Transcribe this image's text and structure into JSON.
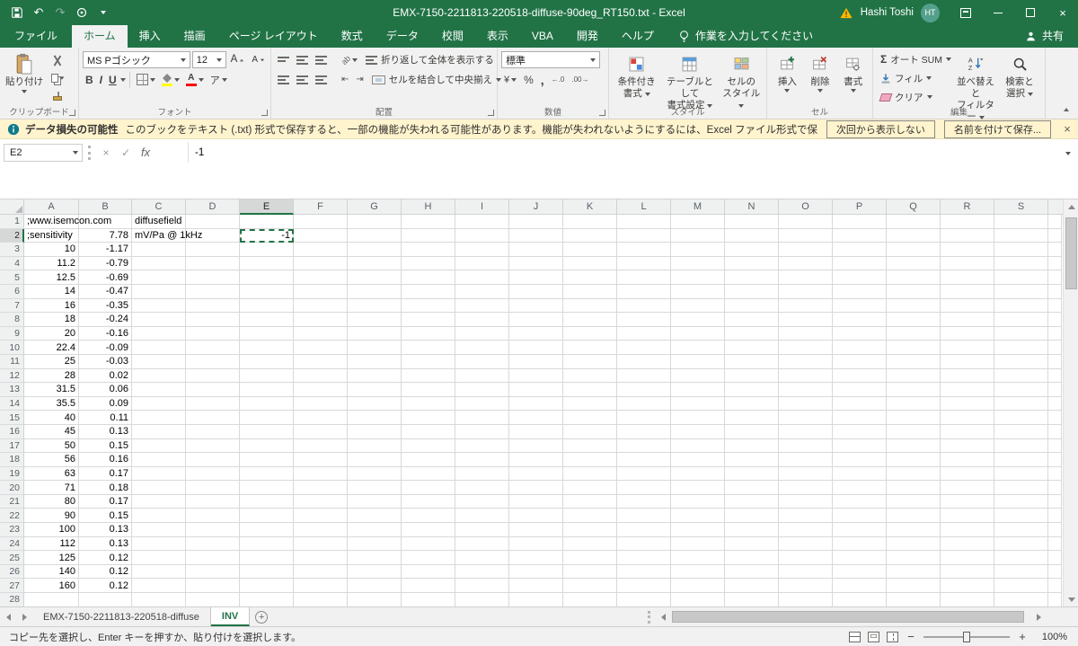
{
  "colors": {
    "excel_green": "#217346",
    "ribbon_bg": "#f1f1f1",
    "warning_bar_bg": "#fff4ce",
    "warning_icon": "#ffb900",
    "info_icon": "#0f7b8a",
    "avatar_bg": "#55a08c",
    "selection_green": "#217346",
    "fill_color_swatch": "#ffff00",
    "font_color_swatch": "#ff0000"
  },
  "title_bar": {
    "title": "EMX-7150-2211813-220518-diffuse-90deg_RT150.txt  -  Excel",
    "user_name": "Hashi Toshi",
    "user_initials": "HT"
  },
  "ribbon_tabs": {
    "file": "ファイル",
    "tabs": [
      {
        "key": "home",
        "label": "ホーム",
        "active": true
      },
      {
        "key": "insert",
        "label": "挿入",
        "active": false
      },
      {
        "key": "draw",
        "label": "描画",
        "active": false
      },
      {
        "key": "page-layout",
        "label": "ページ レイアウト",
        "active": false
      },
      {
        "key": "formulas",
        "label": "数式",
        "active": false
      },
      {
        "key": "data",
        "label": "データ",
        "active": false
      },
      {
        "key": "review",
        "label": "校閲",
        "active": false
      },
      {
        "key": "view",
        "label": "表示",
        "active": false
      },
      {
        "key": "vba",
        "label": "VBA",
        "active": false
      },
      {
        "key": "developer",
        "label": "開発",
        "active": false
      },
      {
        "key": "help",
        "label": "ヘルプ",
        "active": false
      }
    ],
    "tell_me": "作業を入力してください",
    "share": "共有"
  },
  "ribbon": {
    "clipboard": {
      "group_label": "クリップボード",
      "paste": "貼り付け"
    },
    "font": {
      "group_label": "フォント",
      "font_name": "MS Pゴシック",
      "font_size": "12"
    },
    "alignment": {
      "group_label": "配置",
      "wrap_text": "折り返して全体を表示する",
      "merge_center": "セルを結合して中央揃え"
    },
    "number": {
      "group_label": "数値",
      "format": "標準"
    },
    "styles": {
      "group_label": "スタイル",
      "conditional_line1": "条件付き",
      "conditional_line2": "書式",
      "table_line1": "テーブルとして",
      "table_line2": "書式設定",
      "cellstyles_line1": "セルの",
      "cellstyles_line2": "スタイル"
    },
    "cells": {
      "group_label": "セル",
      "insert": "挿入",
      "delete": "削除",
      "format": "書式"
    },
    "editing": {
      "group_label": "編集",
      "autosum": "オート SUM",
      "fill": "フィル",
      "clear": "クリア",
      "sort_line1": "並べ替えと",
      "sort_line2": "フィルター",
      "find_line1": "検索と",
      "find_line2": "選択"
    }
  },
  "icons": {
    "undo": "↶",
    "redo": "↷",
    "bold": "B",
    "italic": "I",
    "underline": "U",
    "font_size_increase": "A",
    "font_size_decrease": "A",
    "phonetic": "ア",
    "orientation": "ab",
    "currency": "¥",
    "percent": "%",
    "comma": ",",
    "increase_decimal": "←.0",
    "decrease_decimal": ".00→",
    "autosum_sigma": "Σ",
    "cancel": "×",
    "enter": "✓",
    "insert_function": "fx",
    "close": "×",
    "add_sheet": "+"
  },
  "warning_bar": {
    "title": "データ損失の可能性",
    "message": "このブックをテキスト (.txt) 形式で保存すると、一部の機能が失われる可能性があります。機能が失われないようにするには、Excel ファイル形式で保存してください。",
    "dismiss_button": "次回から表示しない",
    "save_as_button": "名前を付けて保存..."
  },
  "formula_bar": {
    "name_box": "E2",
    "value": "-1"
  },
  "grid": {
    "column_headers": [
      "A",
      "B",
      "C",
      "D",
      "E",
      "F",
      "G",
      "H",
      "I",
      "J",
      "K",
      "L",
      "M",
      "N",
      "O",
      "P",
      "Q",
      "R",
      "S"
    ],
    "selected_column": "E",
    "selected_row": 2,
    "active_cell": "E2",
    "rows": [
      {
        "n": 1,
        "cells": {
          "A": ";www.isemcon.com",
          "C": "diffusefield"
        }
      },
      {
        "n": 2,
        "cells": {
          "A": ";sensitivity",
          "B": "7.78",
          "C": "mV/Pa @ 1kHz",
          "E": "-1"
        }
      },
      {
        "n": 3,
        "cells": {
          "A": "10",
          "B": "-1.17"
        }
      },
      {
        "n": 4,
        "cells": {
          "A": "11.2",
          "B": "-0.79"
        }
      },
      {
        "n": 5,
        "cells": {
          "A": "12.5",
          "B": "-0.69"
        }
      },
      {
        "n": 6,
        "cells": {
          "A": "14",
          "B": "-0.47"
        }
      },
      {
        "n": 7,
        "cells": {
          "A": "16",
          "B": "-0.35"
        }
      },
      {
        "n": 8,
        "cells": {
          "A": "18",
          "B": "-0.24"
        }
      },
      {
        "n": 9,
        "cells": {
          "A": "20",
          "B": "-0.16"
        }
      },
      {
        "n": 10,
        "cells": {
          "A": "22.4",
          "B": "-0.09"
        }
      },
      {
        "n": 11,
        "cells": {
          "A": "25",
          "B": "-0.03"
        }
      },
      {
        "n": 12,
        "cells": {
          "A": "28",
          "B": "0.02"
        }
      },
      {
        "n": 13,
        "cells": {
          "A": "31.5",
          "B": "0.06"
        }
      },
      {
        "n": 14,
        "cells": {
          "A": "35.5",
          "B": "0.09"
        }
      },
      {
        "n": 15,
        "cells": {
          "A": "40",
          "B": "0.11"
        }
      },
      {
        "n": 16,
        "cells": {
          "A": "45",
          "B": "0.13"
        }
      },
      {
        "n": 17,
        "cells": {
          "A": "50",
          "B": "0.15"
        }
      },
      {
        "n": 18,
        "cells": {
          "A": "56",
          "B": "0.16"
        }
      },
      {
        "n": 19,
        "cells": {
          "A": "63",
          "B": "0.17"
        }
      },
      {
        "n": 20,
        "cells": {
          "A": "71",
          "B": "0.18"
        }
      },
      {
        "n": 21,
        "cells": {
          "A": "80",
          "B": "0.17"
        }
      },
      {
        "n": 22,
        "cells": {
          "A": "90",
          "B": "0.15"
        }
      },
      {
        "n": 23,
        "cells": {
          "A": "100",
          "B": "0.13"
        }
      },
      {
        "n": 24,
        "cells": {
          "A": "112",
          "B": "0.13"
        }
      },
      {
        "n": 25,
        "cells": {
          "A": "125",
          "B": "0.12"
        }
      },
      {
        "n": 26,
        "cells": {
          "A": "140",
          "B": "0.12"
        }
      },
      {
        "n": 27,
        "cells": {
          "A": "160",
          "B": "0.12"
        }
      },
      {
        "n": 28,
        "cells": {}
      }
    ]
  },
  "sheet_tabs": {
    "tabs": [
      {
        "key": "diffuse",
        "label": "EMX-7150-2211813-220518-diffuse",
        "active": false
      },
      {
        "key": "inv",
        "label": "INV",
        "active": true
      }
    ]
  },
  "status_bar": {
    "message": "コピー先を選択し、Enter キーを押すか、貼り付けを選択します。",
    "zoom": "100%"
  }
}
